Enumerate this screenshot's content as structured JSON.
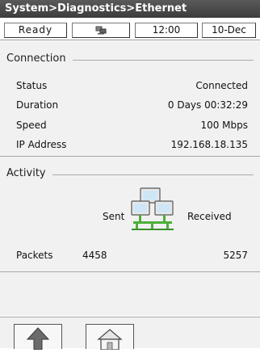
{
  "title": "System>Diagnostics>Ethernet",
  "statusbar": {
    "state": "Ready",
    "network_icon": "network-icon",
    "time": "12:00",
    "date": "10-Dec"
  },
  "connection": {
    "section_label": "Connection",
    "status_label": "Status",
    "status_value": "Connected",
    "duration_label": "Duration",
    "duration_value": "0 Days 00:32:29",
    "speed_label": "Speed",
    "speed_value": "100 Mbps",
    "ip_label": "IP Address",
    "ip_value": "192.168.18.135"
  },
  "activity": {
    "section_label": "Activity",
    "sent_label": "Sent",
    "received_label": "Received",
    "packets_label": "Packets",
    "packets_sent": "4458",
    "packets_received": "5257",
    "icon": "network-computers-icon"
  },
  "navigation": {
    "up_icon": "up-arrow-icon",
    "home_icon": "home-icon"
  },
  "colors": {
    "titlebar": "#4a4a4a",
    "panel_bg": "#f1f1f1",
    "net_green": "#4caf3a"
  }
}
